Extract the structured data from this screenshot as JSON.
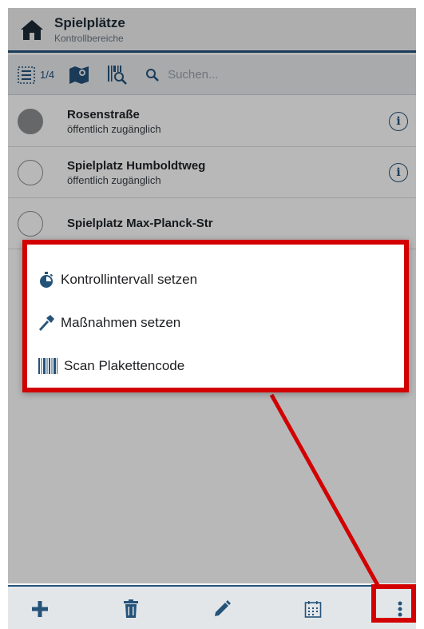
{
  "header": {
    "title": "Spielplätze",
    "subtitle": "Kontrollbereiche"
  },
  "toolbar": {
    "count": "1/4",
    "search_placeholder": "Suchen..."
  },
  "list": [
    {
      "title": "Rosenstraße",
      "subtitle": "öffentlich zugänglich",
      "selected": true,
      "info": "i"
    },
    {
      "title": "Spielplatz Humboldtweg",
      "subtitle": "öffentlich zugänglich",
      "selected": false,
      "info": "i"
    },
    {
      "title": "Spielplatz Max-Planck-Str",
      "subtitle": "",
      "selected": false,
      "info": ""
    }
  ],
  "menu": {
    "items": [
      {
        "label": "Kontrollintervall setzen",
        "icon": "stopwatch-icon"
      },
      {
        "label": "Maßnahmen setzen",
        "icon": "hammer-icon"
      },
      {
        "label": "Scan Plakettencode",
        "icon": "barcode-icon"
      }
    ]
  },
  "bottombar": {
    "icons": [
      "plus-icon",
      "trash-icon",
      "pencil-icon",
      "calendar-icon",
      "more-vert-icon"
    ]
  },
  "colors": {
    "primary": "#24537a",
    "highlight": "#d20000"
  }
}
